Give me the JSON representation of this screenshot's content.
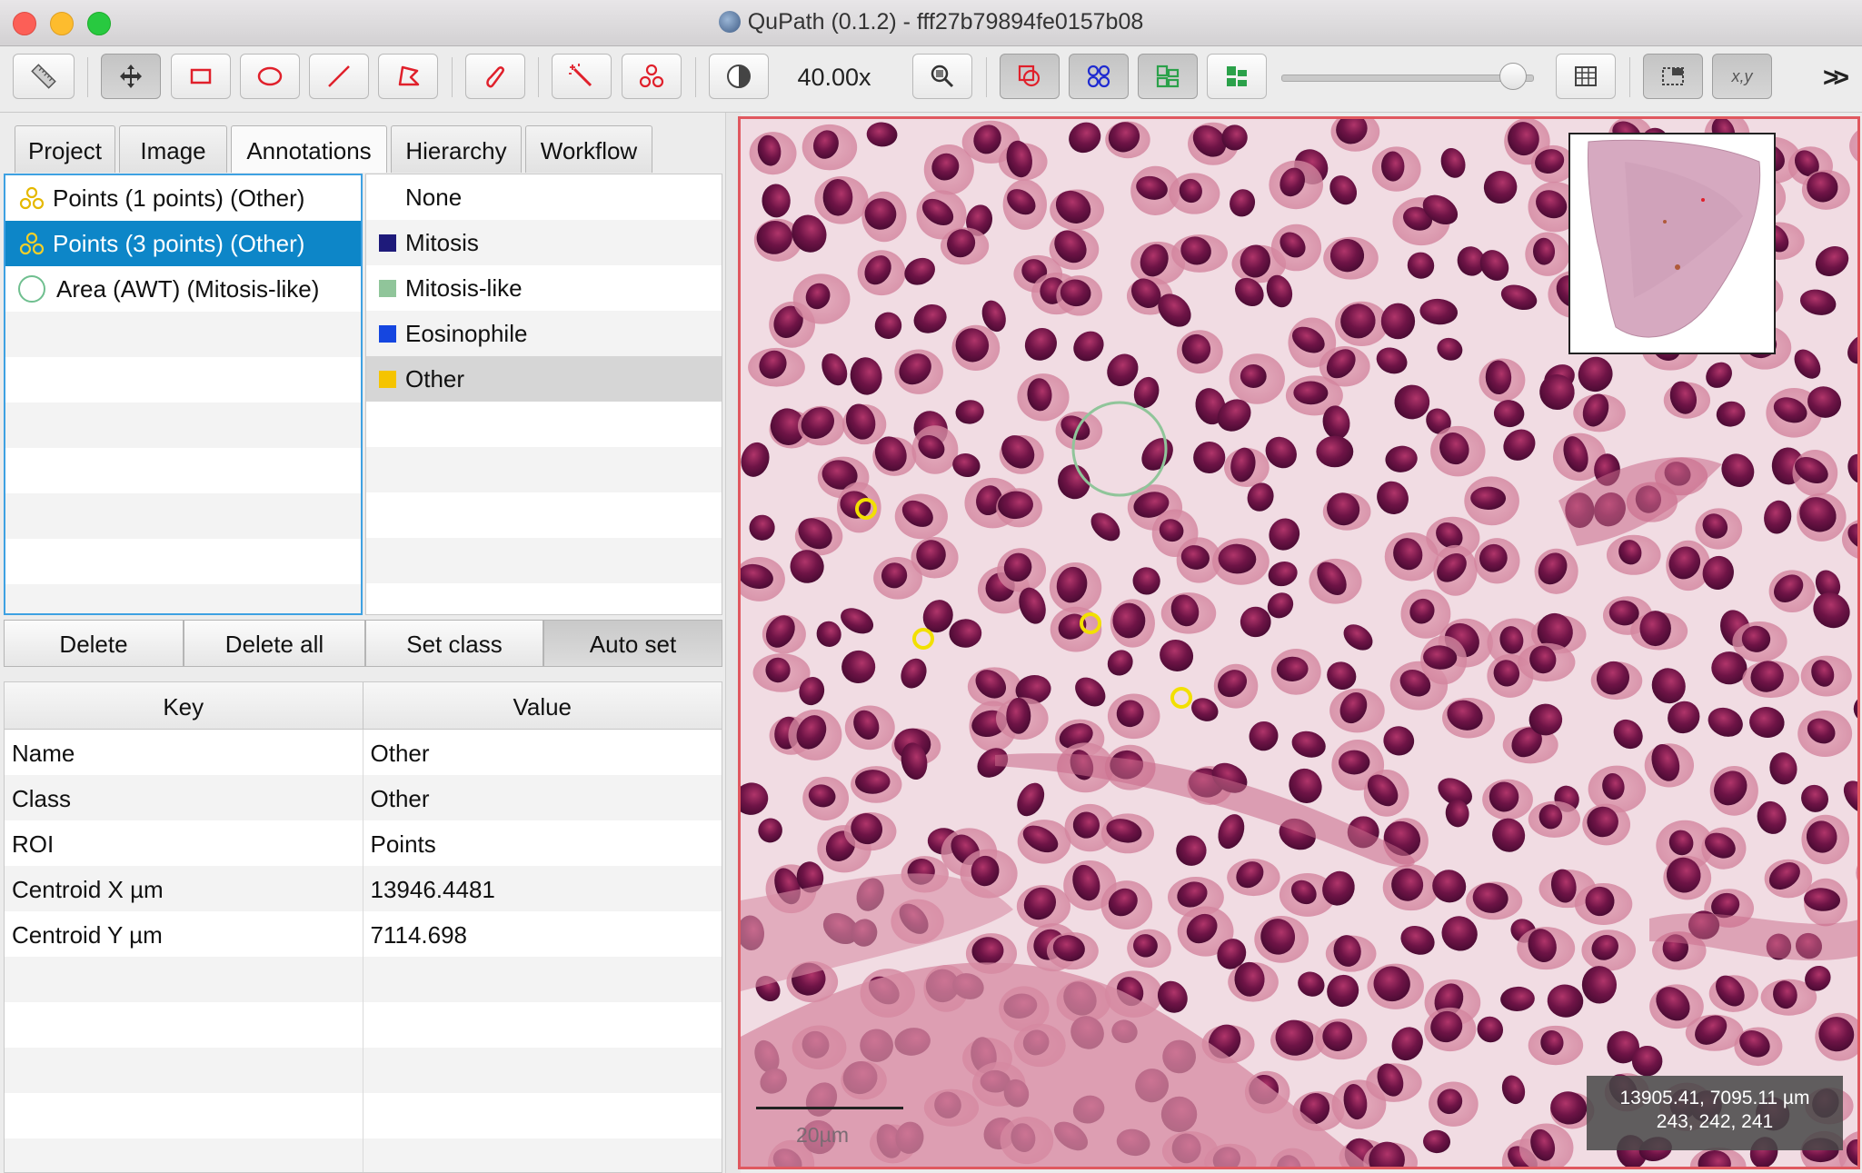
{
  "window": {
    "title": "QuPath (0.1.2) - fff27b79894fe0157b08"
  },
  "toolbar": {
    "magnification": "40.00x",
    "coord_toggle": "x,y",
    "overflow": "»",
    "slider_value_fraction": 0.97,
    "icons": [
      "ruler-icon",
      "move-icon",
      "rectangle-icon",
      "ellipse-icon",
      "line-icon",
      "polygon-icon",
      "brush-icon",
      "wand-icon",
      "points-icon",
      "contrast-icon",
      "zoom-to-fit-icon",
      "show-annotations-icon",
      "show-tma-grid-icon",
      "show-detections-icon",
      "fill-detections-icon",
      "opacity-slider",
      "measurement-table-icon",
      "overview-icon",
      "coordinates-icon"
    ]
  },
  "tabs": [
    "Project",
    "Image",
    "Annotations",
    "Hierarchy",
    "Workflow"
  ],
  "annotations": [
    {
      "label": "Points (1 points) (Other)",
      "icon": "points-icon",
      "selected": false
    },
    {
      "label": "Points (3 points) (Other)",
      "icon": "points-icon",
      "selected": true
    },
    {
      "label": "Area (AWT) (Mitosis-like)",
      "icon": "ellipse-area-icon",
      "selected": false
    }
  ],
  "classes": [
    {
      "label": "None",
      "color": null
    },
    {
      "label": "Mitosis",
      "color": "#1e1a7a"
    },
    {
      "label": "Mitosis-like",
      "color": "#90c59a"
    },
    {
      "label": "Eosinophile",
      "color": "#1546e0"
    },
    {
      "label": "Other",
      "color": "#f5c400"
    }
  ],
  "buttons": {
    "delete": "Delete",
    "delete_all": "Delete all",
    "set_class": "Set class",
    "auto_set": "Auto set"
  },
  "measurements": {
    "headers": {
      "key": "Key",
      "value": "Value"
    },
    "rows": [
      {
        "key": "Name",
        "value": "Other"
      },
      {
        "key": "Class",
        "value": "Other"
      },
      {
        "key": "ROI",
        "value": "Points"
      },
      {
        "key": "Centroid X µm",
        "value": "13946.4481"
      },
      {
        "key": "Centroid Y µm",
        "value": "7114.698"
      }
    ]
  },
  "viewer": {
    "scale_label": "20µm",
    "cursor_position": "13905.41, 7095.11 µm",
    "cursor_rgb": "243, 242, 241",
    "point_color": "#f2e000",
    "area_color": "#90c59a"
  }
}
